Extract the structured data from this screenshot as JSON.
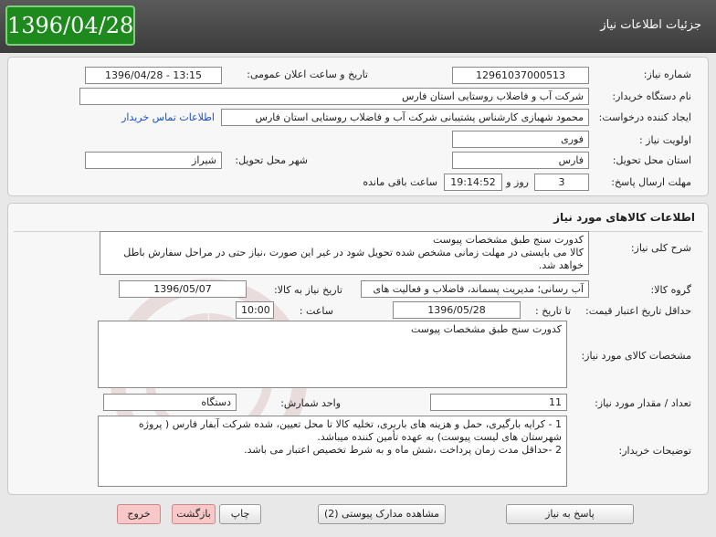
{
  "header": {
    "title": "جزئیات اطلاعات نیاز",
    "date": "1396/04/28"
  },
  "info": {
    "need_number_label": "شماره نیاز:",
    "need_number": "12961037000513",
    "announce_label": "تاریخ و ساعت اعلان عمومی:",
    "announce_value": "1396/04/28 - 13:15",
    "buyer_org_label": "نام دستگاه خریدار:",
    "buyer_org": "شرکت آب و فاضلاب روستایی استان فارس",
    "creator_label": "ایجاد کننده درخواست:",
    "creator": "محمود  شهبازی کارشناس پشتیبانی شرکت آب و فاضلاب روستایی استان فارس",
    "contact_link": "اطلاعات تماس خریدار",
    "priority_label": "اولویت نیاز :",
    "priority": "فوری",
    "province_label": "استان محل تحویل:",
    "province": "فارس",
    "city_label": "شهر محل تحویل:",
    "city": "شیراز",
    "deadline_label": "مهلت ارسال پاسخ:",
    "days": "3",
    "days_word": "روز و",
    "time_remaining": "19:14:52",
    "remaining_word": "ساعت باقی مانده"
  },
  "goods": {
    "section_title": "اطلاعات کالاهای مورد نیاز",
    "desc_label": "شرح کلی نیاز:",
    "desc": "کدورت سنج طبق مشخصات پیوست\nکالا می بایستی در مهلت زمانی مشخص شده تحویل شود در غیر این صورت ،نیاز حتی در مراحل سفارش باطل خواهد شد.",
    "group_label": "گروه کالا:",
    "group": "آب رسانی؛ مدیریت پسماند، فاضلاب و فعالیت های",
    "need_date_label": "تاریخ نیاز به کالا:",
    "need_date": "1396/05/07",
    "validity_label": "حداقل تاریخ اعتبار قیمت:",
    "until_label": "تا تاریخ :",
    "validity_date": "1396/05/28",
    "hour_label": "ساعت :",
    "hour": "10:00",
    "specs_label": "مشخصات کالای مورد نیاز:",
    "specs": "کدورت سنج طبق مشخصات پیوست",
    "qty_label": "تعداد / مقدار مورد نیاز:",
    "qty": "11",
    "unit_label": "واحد شمارش:",
    "unit": "دستگاه",
    "buyer_notes_label": "توضیحات خریدار:",
    "buyer_notes": "1 - کرایه بارگیری، حمل و هزینه های باربری، تخلیه کالا تا محل تعیین، شده شرکت آبفار فارس ( پروژه شهرستان های لیست پیوست) به عهده تأمین کننده میباشد.\n2 -حداقل مدت زمان پرداخت ،شش ماه و به شرط تخصیص اعتبار می باشد."
  },
  "buttons": {
    "reply": "پاسخ به نیاز",
    "attachments": "مشاهده مدارک پیوستی (2)",
    "print": "چاپ",
    "back": "بازگشت",
    "exit": "خروج"
  },
  "colors": {
    "header_bg": "#4a4a4a",
    "date_bg": "#1e8a1e",
    "link": "#1a4fc4",
    "red_btn": "#f8c8c8"
  }
}
